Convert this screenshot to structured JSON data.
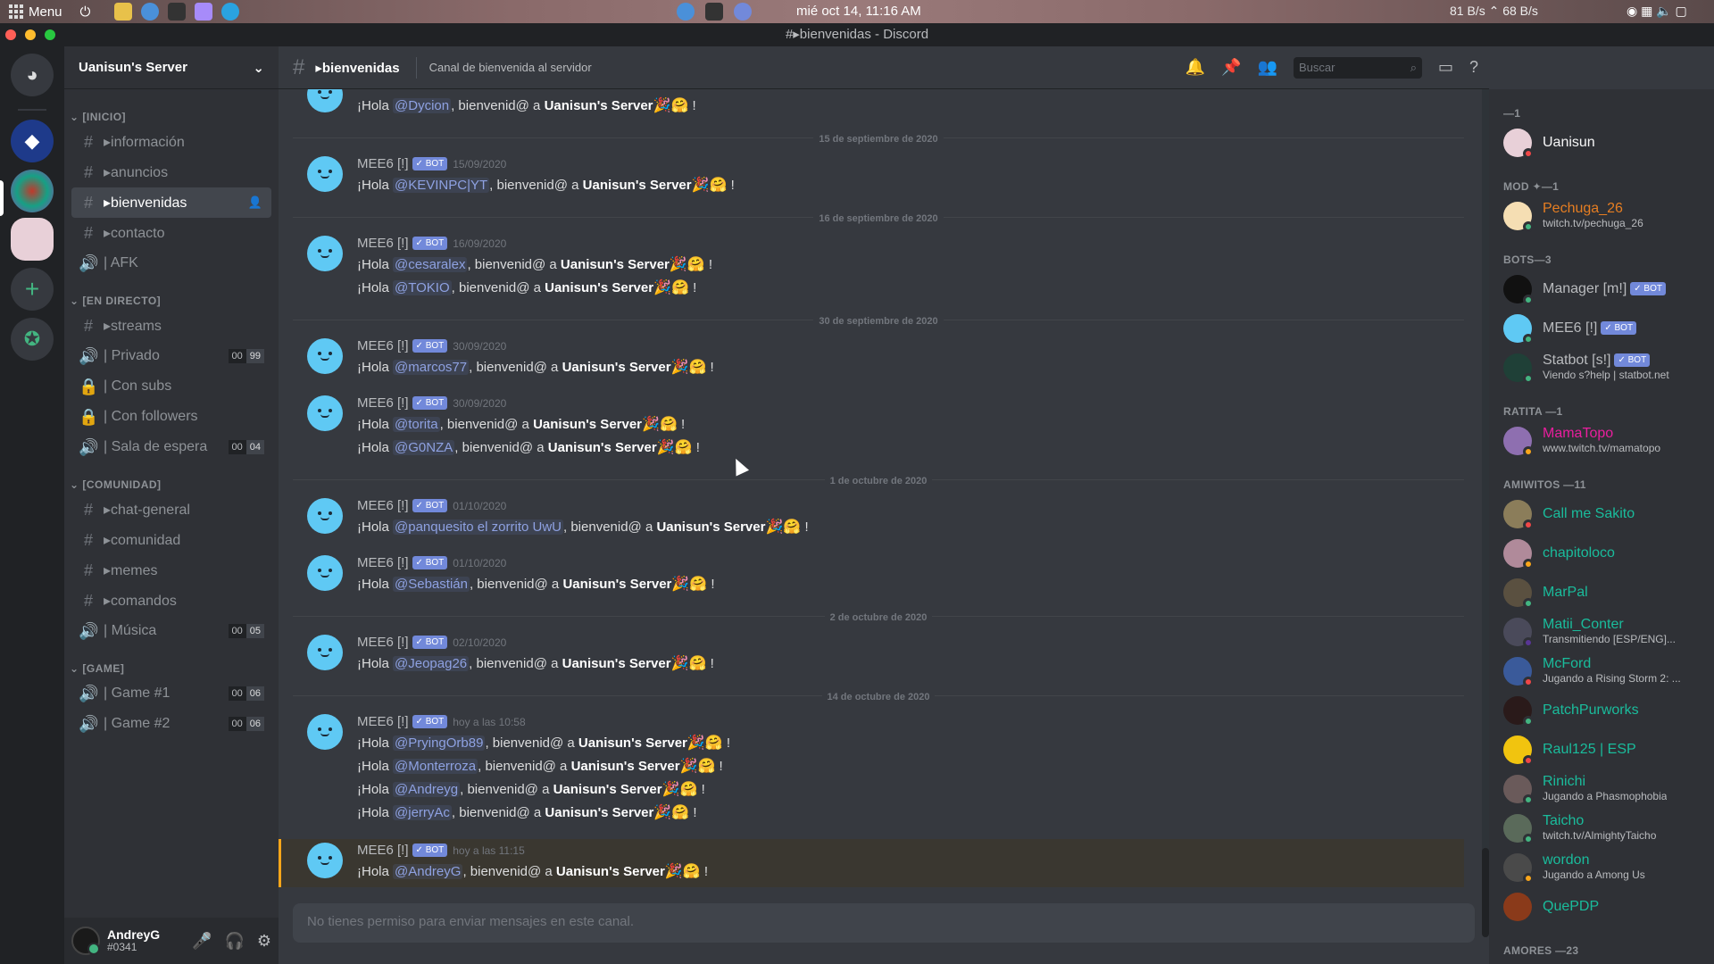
{
  "os": {
    "menu_label": "Menu",
    "clock": "mié oct 14, 11:16 AM",
    "net": "81 B/s ⌃ 68 B/s"
  },
  "window": {
    "title": "#▸bienvenidas - Discord"
  },
  "server": {
    "name": "Uanisun's Server"
  },
  "categories": {
    "inicio": "[INICIO]",
    "directo": "[EN DIRECTO]",
    "comunidad": "[COMUNIDAD]",
    "game": "[GAME]"
  },
  "channels": {
    "informacion": "▸información",
    "anuncios": "▸anuncios",
    "bienvenidas": "▸bienvenidas",
    "contacto": "▸contacto",
    "afk": "| AFK",
    "streams": "▸streams",
    "privado": "| Privado",
    "privado_counts": [
      "00",
      "99"
    ],
    "con_subs": "| Con subs",
    "con_followers": "| Con followers",
    "sala": "| Sala de espera",
    "sala_counts": [
      "00",
      "04"
    ],
    "chat_general": "▸chat-general",
    "comunidad": "▸comunidad",
    "memes": "▸memes",
    "comandos": "▸comandos",
    "musica": "| Música",
    "musica_counts": [
      "00",
      "05"
    ],
    "game1": "| Game #1",
    "game1_counts": [
      "00",
      "06"
    ],
    "game2": "| Game #2",
    "game2_counts": [
      "00",
      "06"
    ]
  },
  "user": {
    "name": "AndreyG",
    "tag": "#0341"
  },
  "header": {
    "channel": "▸bienvenidas",
    "topic": "Canal de bienvenida al servidor",
    "search_placeholder": "Buscar"
  },
  "chat": {
    "greeting": "¡Hola ",
    "mid": ", bienvenid@ a ",
    "server": "Uanisun's Server",
    "emoji": "🎉🤗",
    "end": " !",
    "author": "MEE6 [!]",
    "bot": "✓ BOT",
    "d1": "15 de septiembre de 2020",
    "d2": "16 de septiembre de 2020",
    "d3": "30 de septiembre de 2020",
    "d4": "1 de octubre de 2020",
    "d5": "2 de octubre de 2020",
    "d6": "14 de octubre de 2020",
    "m0": "@Dycion",
    "t1": "15/09/2020",
    "m1": "@KEVINPC|YT",
    "t2": "16/09/2020",
    "m2a": "@cesaralex",
    "m2b": "@TOKIO",
    "t3": "30/09/2020",
    "m3": "@marcos77",
    "t4": "30/09/2020",
    "m4a": "@torita",
    "m4b": "@G0NZA",
    "t5": "01/10/2020",
    "m5": "@panquesito el zorrito UwU",
    "t6": "01/10/2020",
    "m6": "@Sebastián",
    "t7": "02/10/2020",
    "m7": "@Jeopag26",
    "t8": "hoy a las 10:58",
    "m8a": "@PryingOrb89",
    "m8b": "@Monterroza",
    "m8c": "@Andreyg",
    "m8d": "@jerryAc",
    "t9": "hoy a las 11:15",
    "m9": "@AndreyG",
    "input_placeholder": "No tienes permiso para enviar mensajes en este canal."
  },
  "members": {
    "cat_owner": "—1",
    "cat_mod": "MOD ✦—1",
    "cat_bots": "BOTS—3",
    "cat_ratita": "RATITA —1",
    "cat_amiwitos": "AMIWITOS —11",
    "cat_amores": "AMORES —23",
    "bot": "✓ BOT",
    "list": [
      {
        "name": "Uanisun",
        "status": "",
        "color": "#f6f6f7"
      },
      {
        "name": "Pechuga_26",
        "status": "twitch.tv/pechuga_26",
        "color": "#e67e22"
      },
      {
        "name": "Manager [m!]",
        "status": "",
        "color": "#b9bbbe"
      },
      {
        "name": "MEE6 [!]",
        "status": "",
        "color": "#b9bbbe"
      },
      {
        "name": "Statbot [s!]",
        "status": "Viendo s?help | statbot.net",
        "color": "#b9bbbe"
      },
      {
        "name": "MamaTopo",
        "status": "www.twitch.tv/mamatopo",
        "color": "#e91e9e"
      },
      {
        "name": "Call me Sakito",
        "status": "",
        "color": "#1abc9c"
      },
      {
        "name": "chapitoloco",
        "status": "",
        "color": "#1abc9c"
      },
      {
        "name": "MarPal",
        "status": "",
        "color": "#1abc9c"
      },
      {
        "name": "Matii_Conter",
        "status": "Transmitiendo [ESP/ENG]...",
        "color": "#1abc9c"
      },
      {
        "name": "McFord",
        "status": "Jugando a Rising Storm 2: ...",
        "color": "#1abc9c"
      },
      {
        "name": "PatchPurworks",
        "status": "",
        "color": "#1abc9c"
      },
      {
        "name": "Raul125 | ESP",
        "status": "",
        "color": "#1abc9c"
      },
      {
        "name": "Rinichi",
        "status": "Jugando a Phasmophobia",
        "color": "#1abc9c"
      },
      {
        "name": "Taicho",
        "status": "twitch.tv/AlmightyTaicho",
        "color": "#1abc9c"
      },
      {
        "name": "wordon",
        "status": "Jugando a Among Us",
        "color": "#1abc9c"
      },
      {
        "name": "QuePDP",
        "status": "",
        "color": "#1abc9c"
      }
    ]
  }
}
